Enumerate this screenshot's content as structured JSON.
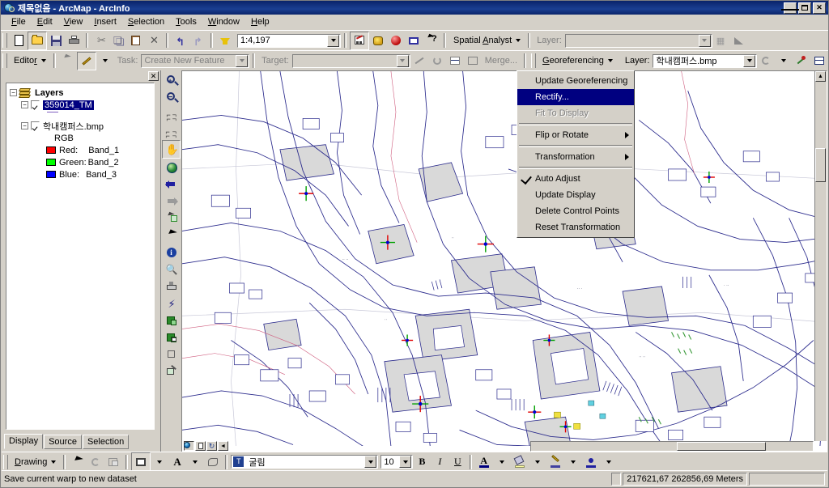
{
  "window": {
    "title": "제목없음 - ArcMap - ArcInfo",
    "icon": "arcmap-globe-icon",
    "buttons": {
      "minimize": "Minimize",
      "restore": "Restore",
      "close": "Close"
    }
  },
  "menubar": {
    "items": [
      {
        "label": "File",
        "mnemonic": "F"
      },
      {
        "label": "Edit",
        "mnemonic": "E"
      },
      {
        "label": "View",
        "mnemonic": "V"
      },
      {
        "label": "Insert",
        "mnemonic": "I"
      },
      {
        "label": "Selection",
        "mnemonic": "S"
      },
      {
        "label": "Tools",
        "mnemonic": "T"
      },
      {
        "label": "Window",
        "mnemonic": "W"
      },
      {
        "label": "Help",
        "mnemonic": "H"
      }
    ]
  },
  "standard_toolbar": {
    "buttons": [
      "new-document-icon",
      "open-folder-icon",
      "save-icon",
      "print-icon",
      "cut-icon",
      "copy-icon",
      "paste-icon",
      "delete-icon",
      "undo-icon",
      "redo-icon",
      "add-data-icon"
    ],
    "scale_label": "1:4,197",
    "after_scale_buttons": [
      "editor-toolbar-icon",
      "arctoolbox-icon",
      "show-commands-icon",
      "map-window-icon",
      "whats-this-icon"
    ],
    "spatial_analyst": {
      "label": "Spatial Analyst",
      "mnemonic": "A"
    },
    "layer_label": "Layer:",
    "layer_value": "",
    "layer_disabled": true
  },
  "editor_toolbar": {
    "editor_button": "Editor",
    "task_label": "Task:",
    "task_value": "Create New Feature",
    "target_label": "Target:",
    "target_value": "",
    "disabled": true,
    "merge_label": "Merge..."
  },
  "georeferencing_toolbar": {
    "button": "Georeferencing",
    "mnemonic": "G",
    "layer_label": "Layer:",
    "layer_value": "학내캠퍼스.bmp",
    "trailing_icons": [
      "rotate-icon",
      "add-control-points-icon",
      "view-link-table-icon"
    ]
  },
  "georeferencing_menu": {
    "items": [
      {
        "label": "Update Georeferencing",
        "state": "normal",
        "submenu": false,
        "checked": false
      },
      {
        "label": "Rectify...",
        "state": "highlighted",
        "submenu": false,
        "checked": false
      },
      {
        "label": "Fit To Display",
        "state": "disabled",
        "submenu": false,
        "checked": false
      },
      {
        "label": "Flip or Rotate",
        "state": "normal",
        "submenu": true,
        "checked": false
      },
      {
        "label": "Transformation",
        "state": "normal",
        "submenu": true,
        "checked": false
      },
      {
        "label": "Auto Adjust",
        "state": "normal",
        "submenu": false,
        "checked": true
      },
      {
        "label": "Update Display",
        "state": "normal",
        "submenu": false,
        "checked": false
      },
      {
        "label": "Delete Control Points",
        "state": "normal",
        "submenu": false,
        "checked": false
      },
      {
        "label": "Reset Transformation",
        "state": "normal",
        "submenu": false,
        "checked": false
      }
    ]
  },
  "toc": {
    "root": "Layers",
    "layers": [
      {
        "name": "359014_TM",
        "checked": true,
        "selected": true,
        "expanded": true
      },
      {
        "name": "학내캠퍼스.bmp",
        "checked": true,
        "selected": false,
        "expanded": true,
        "renderer": "RGB",
        "bands": [
          {
            "label": "Red:",
            "value": "Band_1",
            "color": "#ff0000"
          },
          {
            "label": "Green:",
            "value": "Band_2",
            "color": "#00ff00"
          },
          {
            "label": "Blue:",
            "value": "Band_3",
            "color": "#0000ff"
          }
        ]
      }
    ],
    "tabs": [
      {
        "label": "Display",
        "active": true
      },
      {
        "label": "Source",
        "active": false
      },
      {
        "label": "Selection",
        "active": false
      }
    ]
  },
  "tool_palette": {
    "tools": [
      {
        "name": "zoom-in-icon",
        "active": false
      },
      {
        "name": "zoom-out-icon",
        "active": false
      },
      {
        "name": "fixed-zoom-in-icon",
        "active": false
      },
      {
        "name": "fixed-zoom-out-icon",
        "active": false
      },
      {
        "name": "pan-hand-icon",
        "active": true
      },
      {
        "name": "full-extent-globe-icon",
        "active": false
      },
      {
        "name": "back-extent-icon",
        "active": false
      },
      {
        "name": "forward-extent-icon",
        "active": false
      },
      {
        "name": "select-features-icon",
        "active": false
      },
      {
        "name": "select-elements-icon",
        "active": false
      },
      {
        "name": "identify-icon",
        "active": false
      },
      {
        "name": "find-icon",
        "active": false
      },
      {
        "name": "measure-icon",
        "active": false
      },
      {
        "name": "hyperlink-icon",
        "active": false
      },
      {
        "name": "html-popup-icon",
        "active": false
      },
      {
        "name": "attribute-transfer-icon",
        "active": false
      },
      {
        "name": "rotate-image-icon",
        "active": false
      }
    ]
  },
  "map_view": {
    "view_buttons": [
      {
        "name": "data-view-icon",
        "active": true
      },
      {
        "name": "layout-view-icon",
        "active": false
      },
      {
        "name": "refresh-view-icon",
        "active": false
      },
      {
        "name": "pause-drawing-icon",
        "active": false
      }
    ]
  },
  "drawing_toolbar": {
    "button": "Drawing",
    "mnemonic": "D",
    "tools": [
      "select-elements-icon",
      "rotate-icon",
      "clip-icon",
      "new-rectangle-icon",
      "new-text-icon",
      "reshape-icon"
    ],
    "font_name": "굴림",
    "font_size": "10",
    "bold": "B",
    "italic": "I",
    "underline": "U",
    "color_buttons": [
      "font-color-icon",
      "fill-color-icon",
      "line-color-icon",
      "marker-color-icon"
    ]
  },
  "statusbar": {
    "message": "Save current warp to new dataset",
    "coordinates": "217621,67  262856,69 Meters"
  },
  "colors": {
    "accent": "#000080",
    "chrome": "#d4d0c8",
    "map_line": "#2a2a8c",
    "map_fill": "#d8d8d8"
  }
}
